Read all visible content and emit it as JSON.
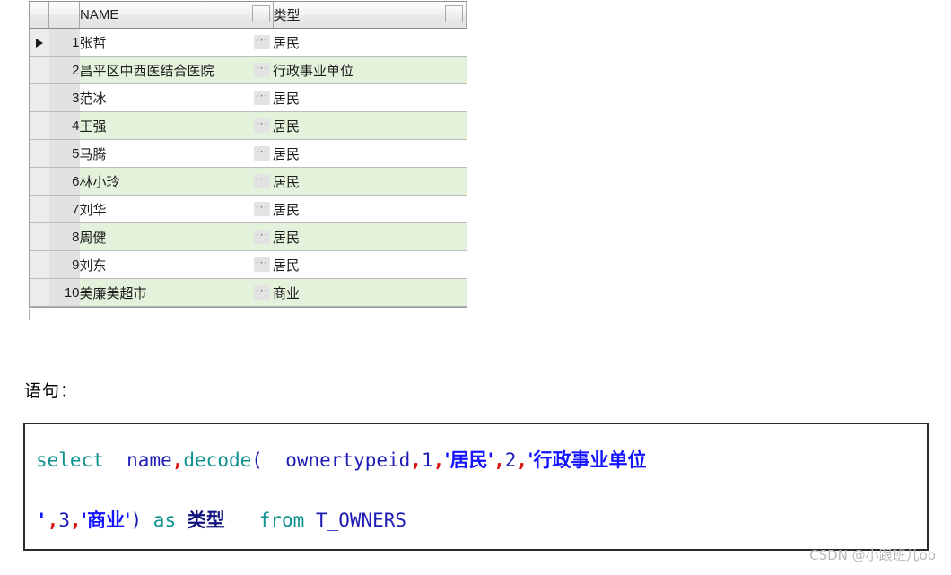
{
  "grid": {
    "columns": [
      {
        "key": "arrow",
        "label": ""
      },
      {
        "key": "num",
        "label": ""
      },
      {
        "key": "name",
        "label": "NAME"
      },
      {
        "key": "type",
        "label": "类型"
      }
    ],
    "current_row_marker": "▶",
    "ellipsis_label": "···",
    "rows": [
      {
        "num": "1",
        "name": "张哲",
        "type": "居民",
        "alt": false,
        "current": true
      },
      {
        "num": "2",
        "name": "昌平区中西医结合医院",
        "type": "行政事业单位",
        "alt": true,
        "current": false
      },
      {
        "num": "3",
        "name": "范冰",
        "type": "居民",
        "alt": false,
        "current": false
      },
      {
        "num": "4",
        "name": "王强",
        "type": "居民",
        "alt": true,
        "current": false
      },
      {
        "num": "5",
        "name": "马腾",
        "type": "居民",
        "alt": false,
        "current": false
      },
      {
        "num": "6",
        "name": "林小玲",
        "type": "居民",
        "alt": true,
        "current": false
      },
      {
        "num": "7",
        "name": "刘华",
        "type": "居民",
        "alt": false,
        "current": false
      },
      {
        "num": "8",
        "name": "周健",
        "type": "居民",
        "alt": true,
        "current": false
      },
      {
        "num": "9",
        "name": "刘东",
        "type": "居民",
        "alt": false,
        "current": false
      },
      {
        "num": "10",
        "name": "美廉美超市",
        "type": "商业",
        "alt": true,
        "current": false
      }
    ]
  },
  "caption": {
    "text": "语句："
  },
  "code": {
    "language": "sql",
    "full_text": "select name,decode(  ownertypeid,1,'居民',2,'行政事业单位',3,'商业') as 类型   from T_OWNERS",
    "line1": {
      "kw_select": "select",
      "sp1": "  ",
      "id_name": "name",
      "comma1": ",",
      "kw_decode": "decode",
      "paren_open": "(",
      "sp2": "  ",
      "id_ownertypeid": "ownertypeid",
      "comma2": ",",
      "num1": "1",
      "comma3": ",",
      "str1": "'居民'",
      "comma4": ",",
      "num2": "2",
      "comma5": ",",
      "str2_open": "'行政事业单位"
    },
    "line2": {
      "str2_close": "'",
      "comma6": ",",
      "num3": "3",
      "comma7": ",",
      "str3": "'商业'",
      "paren_close": ")",
      "sp3": " ",
      "kw_as": "as",
      "sp4": " ",
      "alias": "类型",
      "sp5": "   ",
      "kw_from": "from",
      "sp6": " ",
      "table": "T_OWNERS"
    }
  },
  "watermark": {
    "text": "CSDN @小跟班儿oo"
  },
  "colors": {
    "keyword": "#0f9090",
    "identifier": "#1d1db4",
    "string": "#1414ff",
    "comma": "#d81010",
    "alt_row_bg": "#e4f2dc",
    "header_bg": "#e9e9e9",
    "rownum_bg": "#e2e2e2"
  }
}
